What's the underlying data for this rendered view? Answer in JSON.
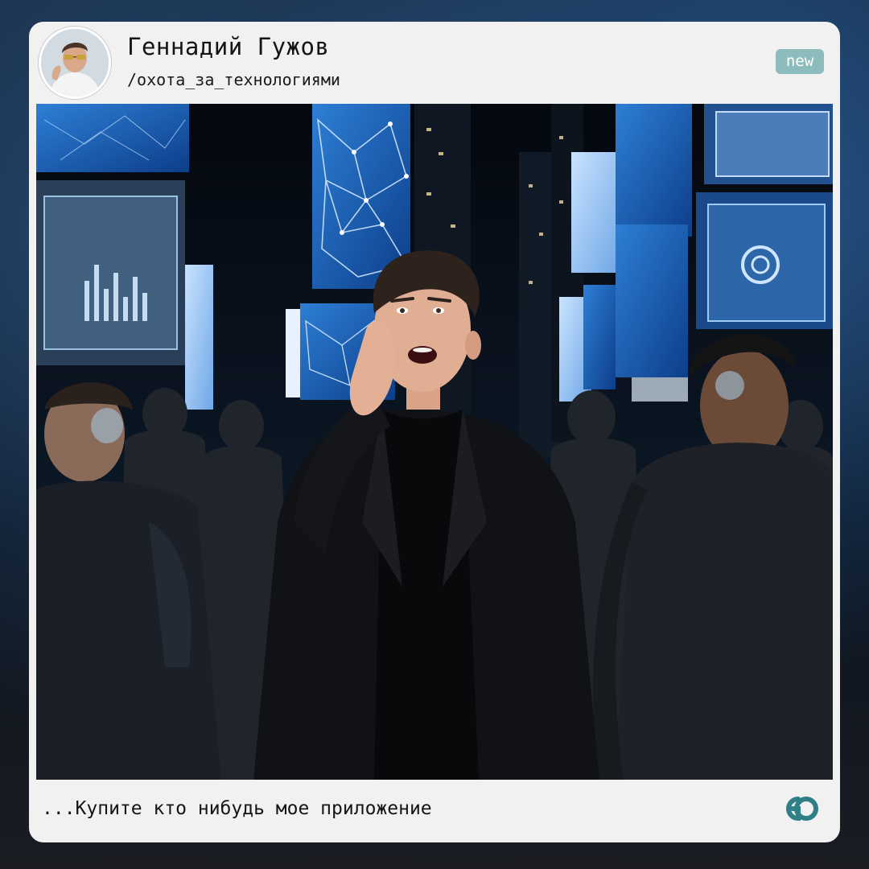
{
  "post": {
    "author_name": "Геннадий Гужов",
    "channel_handle": "/охота_за_технологиями",
    "badge": "new",
    "caption": "...Купите кто нибудь мое приложение"
  },
  "icons": {
    "avatar": "author-avatar-photo",
    "brand": "channel-logo-icon"
  },
  "colors": {
    "card_background": "#f1f1f1",
    "badge_background": "#8dbcbc",
    "badge_text": "#ffffff",
    "brand_icon": "#2f7f86",
    "text": "#141414"
  }
}
